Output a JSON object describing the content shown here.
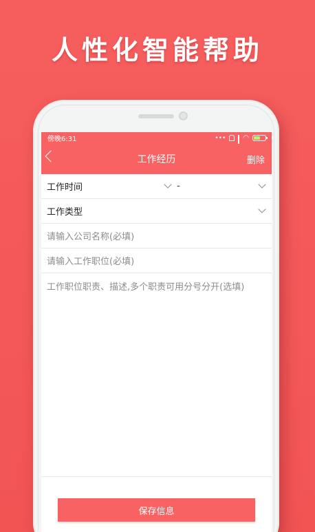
{
  "promo": {
    "headline": "人性化智能帮助"
  },
  "status_bar": {
    "carrier_time": "傍晚6:31",
    "dots": "•••"
  },
  "nav": {
    "title": "工作经历",
    "delete_label": "删除"
  },
  "form": {
    "work_time_label": "工作时间",
    "time_separator": "-",
    "work_type_label": "工作类型",
    "company_placeholder": "请输入公司名称(必填)",
    "position_placeholder": "请输入工作职位(必填)",
    "description_placeholder": "工作职位职责、描述,多个职责可用分号分开(选填)"
  },
  "actions": {
    "save_label": "保存信息"
  },
  "colors": {
    "brand": "#f86262",
    "background": "#f65e5e"
  }
}
